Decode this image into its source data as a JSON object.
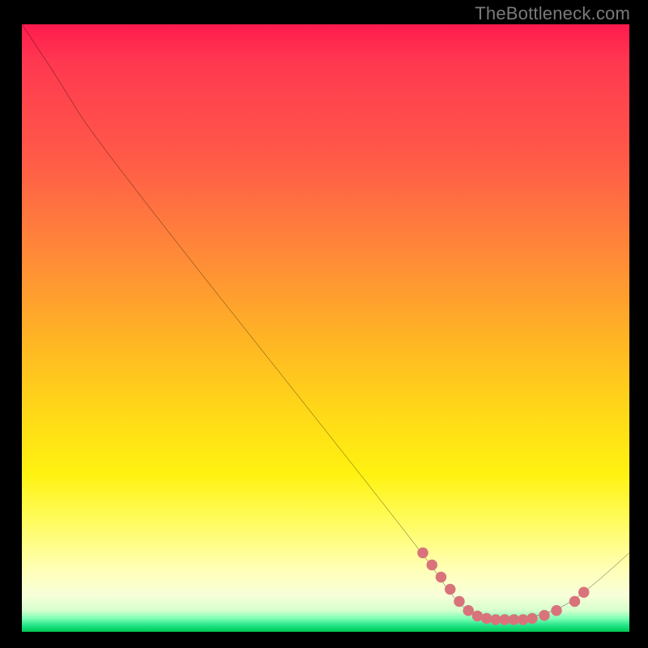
{
  "watermark": "TheBottleneck.com",
  "chart_data": {
    "type": "line",
    "title": "",
    "xlabel": "",
    "ylabel": "",
    "xlim": [
      0,
      100
    ],
    "ylim": [
      100,
      0
    ],
    "curve": {
      "name": "bottleneck-curve",
      "color": "#000000",
      "points": [
        {
          "x": 0,
          "y": 0
        },
        {
          "x": 6,
          "y": 9
        },
        {
          "x": 12,
          "y": 19
        },
        {
          "x": 66,
          "y": 87
        },
        {
          "x": 70,
          "y": 93
        },
        {
          "x": 73,
          "y": 96.5
        },
        {
          "x": 76,
          "y": 97.5
        },
        {
          "x": 80,
          "y": 97.8
        },
        {
          "x": 85,
          "y": 97.5
        },
        {
          "x": 90,
          "y": 95.5
        },
        {
          "x": 95,
          "y": 91.5
        },
        {
          "x": 100,
          "y": 87
        }
      ]
    },
    "markers": {
      "name": "highlight-dots",
      "color": "#d9737b",
      "radius": 5,
      "points": [
        {
          "x": 66,
          "y": 87
        },
        {
          "x": 67.5,
          "y": 89
        },
        {
          "x": 69,
          "y": 91
        },
        {
          "x": 70.5,
          "y": 93
        },
        {
          "x": 72,
          "y": 95
        },
        {
          "x": 73.5,
          "y": 96.5
        },
        {
          "x": 75,
          "y": 97.4
        },
        {
          "x": 76.5,
          "y": 97.8
        },
        {
          "x": 78,
          "y": 98
        },
        {
          "x": 79.5,
          "y": 98
        },
        {
          "x": 81,
          "y": 98
        },
        {
          "x": 82.5,
          "y": 98
        },
        {
          "x": 84,
          "y": 97.8
        },
        {
          "x": 86,
          "y": 97.3
        },
        {
          "x": 88,
          "y": 96.5
        },
        {
          "x": 91,
          "y": 95
        },
        {
          "x": 92.5,
          "y": 93.5
        }
      ]
    }
  }
}
